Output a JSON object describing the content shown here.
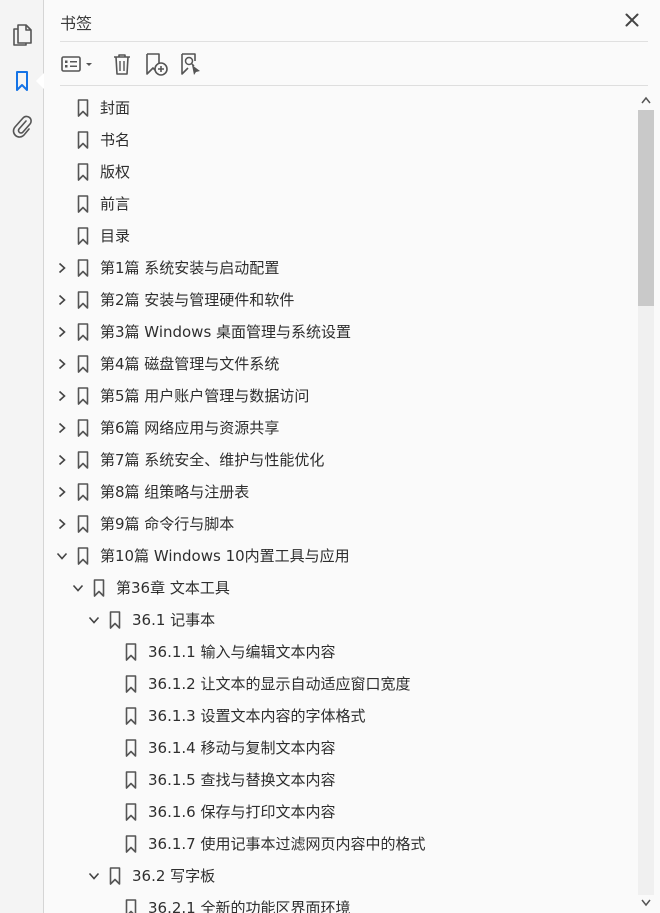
{
  "rail": {
    "items": [
      {
        "icon": "pages-icon"
      },
      {
        "icon": "bookmark-icon",
        "active": true
      },
      {
        "icon": "paperclip-icon"
      }
    ],
    "active_color": "#1473e6"
  },
  "panel": {
    "title": "书签",
    "toolbar": {
      "options_icon": "list-options-icon",
      "delete_icon": "trash-icon",
      "new_icon": "new-bookmark-icon",
      "find_icon": "find-bookmark-icon"
    }
  },
  "bookmarks": [
    {
      "level": 0,
      "expander": "none",
      "label": "封面"
    },
    {
      "level": 0,
      "expander": "none",
      "label": "书名"
    },
    {
      "level": 0,
      "expander": "none",
      "label": "版权"
    },
    {
      "level": 0,
      "expander": "none",
      "label": "前言"
    },
    {
      "level": 0,
      "expander": "none",
      "label": "目录"
    },
    {
      "level": 0,
      "expander": "collapsed",
      "label": "第1篇  系统安装与启动配置"
    },
    {
      "level": 0,
      "expander": "collapsed",
      "label": "第2篇  安装与管理硬件和软件"
    },
    {
      "level": 0,
      "expander": "collapsed",
      "label": "第3篇  Windows 桌面管理与系统设置"
    },
    {
      "level": 0,
      "expander": "collapsed",
      "label": "第4篇  磁盘管理与文件系统"
    },
    {
      "level": 0,
      "expander": "collapsed",
      "label": "第5篇  用户账户管理与数据访问"
    },
    {
      "level": 0,
      "expander": "collapsed",
      "label": "第6篇  网络应用与资源共享"
    },
    {
      "level": 0,
      "expander": "collapsed",
      "label": "第7篇  系统安全、维护与性能优化"
    },
    {
      "level": 0,
      "expander": "collapsed",
      "label": "第8篇  组策略与注册表"
    },
    {
      "level": 0,
      "expander": "collapsed",
      "label": "第9篇  命令行与脚本"
    },
    {
      "level": 0,
      "expander": "expanded",
      "label": "第10篇  Windows 10内置工具与应用"
    },
    {
      "level": 1,
      "expander": "expanded",
      "label": "第36章  文本工具"
    },
    {
      "level": 2,
      "expander": "expanded",
      "label": "36.1  记事本"
    },
    {
      "level": 3,
      "expander": "none",
      "label": "36.1.1  输入与编辑文本内容"
    },
    {
      "level": 3,
      "expander": "none",
      "label": "36.1.2  让文本的显示自动适应窗口宽度"
    },
    {
      "level": 3,
      "expander": "none",
      "label": "36.1.3  设置文本内容的字体格式"
    },
    {
      "level": 3,
      "expander": "none",
      "label": "36.1.4  移动与复制文本内容"
    },
    {
      "level": 3,
      "expander": "none",
      "label": "36.1.5  查找与替换文本内容"
    },
    {
      "level": 3,
      "expander": "none",
      "label": "36.1.6  保存与打印文本内容"
    },
    {
      "level": 3,
      "expander": "none",
      "label": "36.1.7  使用记事本过滤网页内容中的格式"
    },
    {
      "level": 2,
      "expander": "expanded",
      "label": "36.2  写字板"
    },
    {
      "level": 3,
      "expander": "none",
      "label": "36.2.1  全新的功能区界面环境"
    }
  ],
  "scrollbar": {
    "position_fraction": 0.0,
    "visible_fraction": 0.25
  }
}
